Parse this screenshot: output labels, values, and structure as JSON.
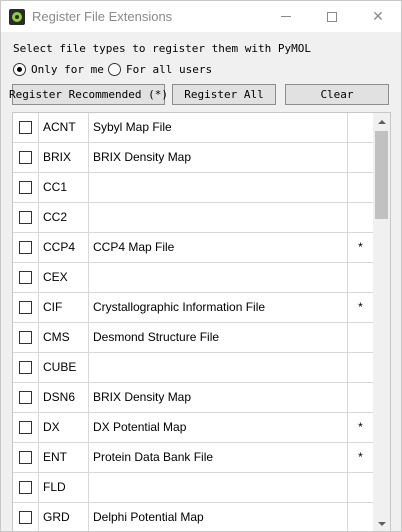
{
  "window": {
    "title": "Register File Extensions",
    "icon": "pymol-app-icon"
  },
  "prompt": "Select file types to register them with PyMOL",
  "radios": [
    {
      "label": "Only for me",
      "checked": true
    },
    {
      "label": "For all users",
      "checked": false
    }
  ],
  "buttons": {
    "recommended": "Register Recommended (*)",
    "all": "Register All",
    "clear": "Clear"
  },
  "rows": [
    {
      "ext": "ACNT",
      "desc": "Sybyl Map File",
      "rec": "",
      "checked": false
    },
    {
      "ext": "BRIX",
      "desc": "BRIX Density Map",
      "rec": "",
      "checked": false
    },
    {
      "ext": "CC1",
      "desc": "",
      "rec": "",
      "checked": false
    },
    {
      "ext": "CC2",
      "desc": "",
      "rec": "",
      "checked": false
    },
    {
      "ext": "CCP4",
      "desc": "CCP4 Map File",
      "rec": "*",
      "checked": false
    },
    {
      "ext": "CEX",
      "desc": "",
      "rec": "",
      "checked": false
    },
    {
      "ext": "CIF",
      "desc": "Crystallographic Information File",
      "rec": "*",
      "checked": false
    },
    {
      "ext": "CMS",
      "desc": "Desmond Structure File",
      "rec": "",
      "checked": false
    },
    {
      "ext": "CUBE",
      "desc": "",
      "rec": "",
      "checked": false
    },
    {
      "ext": "DSN6",
      "desc": "BRIX Density Map",
      "rec": "",
      "checked": false
    },
    {
      "ext": "DX",
      "desc": "DX Potential Map",
      "rec": "*",
      "checked": false
    },
    {
      "ext": "ENT",
      "desc": "Protein Data Bank File",
      "rec": "*",
      "checked": false
    },
    {
      "ext": "FLD",
      "desc": "",
      "rec": "",
      "checked": false
    },
    {
      "ext": "GRD",
      "desc": "Delphi Potential Map",
      "rec": "",
      "checked": false
    }
  ],
  "scrollbar": {
    "position_fraction": 0.0
  }
}
